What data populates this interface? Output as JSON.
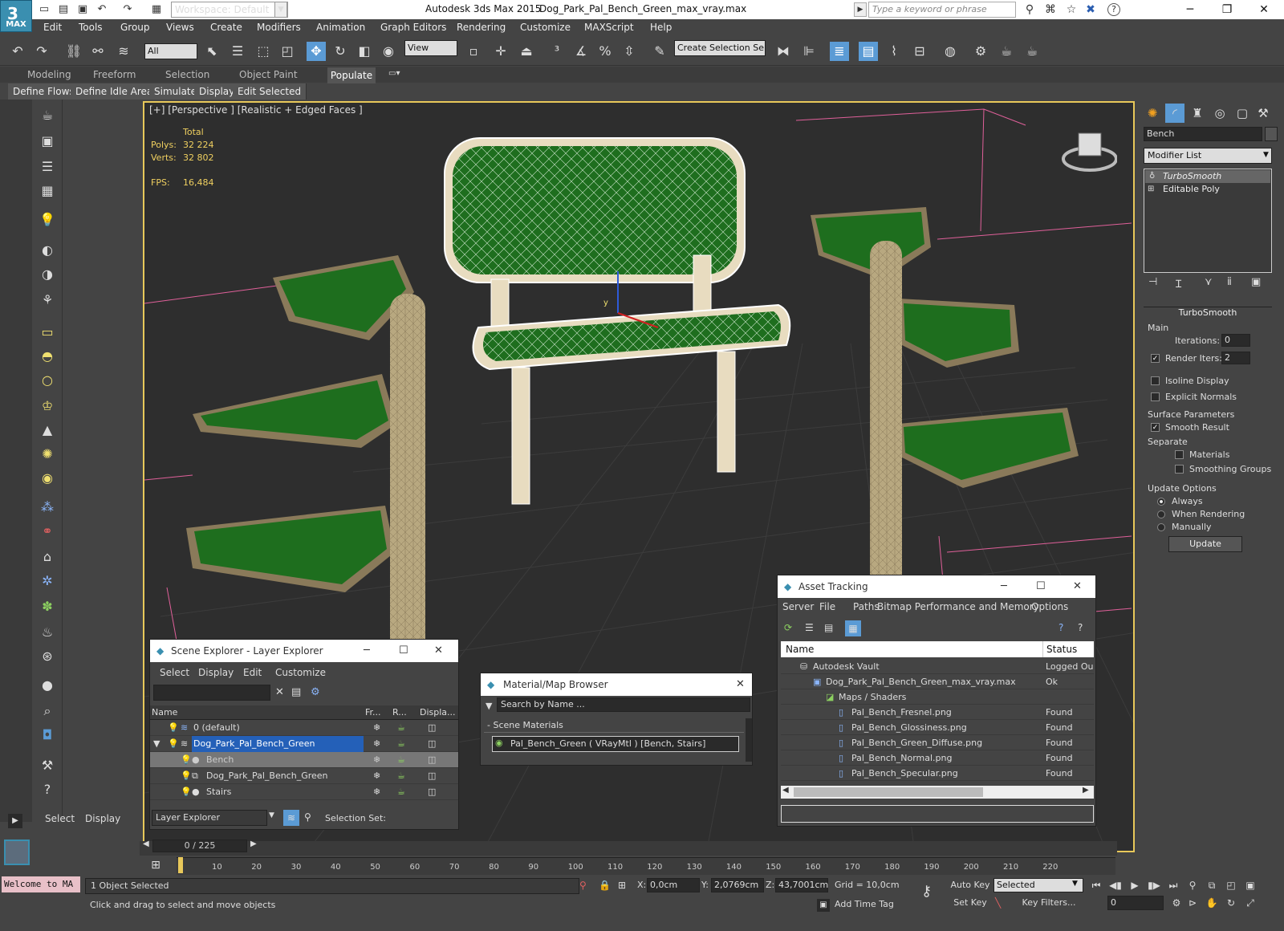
{
  "titlebar": {
    "app_title": "Autodesk 3ds Max  2015",
    "document": "Dog_Park_Pal_Bench_Green_max_vray.max",
    "workspace": "Workspace: Default",
    "search_placeholder": "Type a keyword or phrase",
    "logo_text": "MAX"
  },
  "menu": [
    "Edit",
    "Tools",
    "Group",
    "Views",
    "Create",
    "Modifiers",
    "Animation",
    "Graph Editors",
    "Rendering",
    "Customize",
    "MAXScript",
    "Help"
  ],
  "toolbar": {
    "filter": "All",
    "refcoord": "View",
    "selection_set": "Create Selection Se"
  },
  "ribbon": {
    "tabs": [
      "Modeling",
      "Freeform",
      "Selection",
      "Object Paint",
      "Populate"
    ],
    "active": "Populate",
    "buttons": [
      "Define Flows",
      "Define Idle Areas",
      "Simulate",
      "Display",
      "Edit Selected"
    ]
  },
  "viewport": {
    "label": "[+] [Perspective ] [Realistic + Edged Faces ]",
    "total_label": "Total",
    "polys_label": "Polys:",
    "polys": "32 224",
    "verts_label": "Verts:",
    "verts": "32 802",
    "fps_label": "FPS:",
    "fps": "16,484",
    "axis_y": "y"
  },
  "cmdpanel": {
    "object_name": "Bench",
    "modifier_list": "Modifier List",
    "stack": [
      "TurboSmooth",
      "Editable Poly"
    ],
    "turbosmooth": {
      "title": "TurboSmooth",
      "main": "Main",
      "iterations_label": "Iterations:",
      "iterations": "0",
      "render_iters_label": "Render Iters:",
      "render_iters": "2",
      "isoline": "Isoline Display",
      "explicit": "Explicit Normals",
      "surface": "Surface Parameters",
      "smooth_result": "Smooth Result",
      "separate": "Separate",
      "materials": "Materials",
      "smoothing_groups": "Smoothing Groups",
      "update_options": "Update Options",
      "always": "Always",
      "when_rendering": "When Rendering",
      "manually": "Manually",
      "update": "Update"
    }
  },
  "scene_explorer": {
    "title": "Scene Explorer - Layer Explorer",
    "menu": [
      "Select",
      "Display",
      "Edit",
      "Customize"
    ],
    "columns": [
      "Name",
      "Fr...",
      "R...",
      "Displa..."
    ],
    "rows": [
      {
        "name": "0 (default)"
      },
      {
        "name": "Dog_Park_Pal_Bench_Green"
      },
      {
        "name": "Bench"
      },
      {
        "name": "Dog_Park_Pal_Bench_Green"
      },
      {
        "name": "Stairs"
      }
    ],
    "footer_dd": "Layer Explorer",
    "selection_set": "Selection Set:"
  },
  "material_browser": {
    "title": "Material/Map Browser",
    "search": "Search by Name ...",
    "group": "- Scene Materials",
    "item": "Pal_Bench_Green  ( VRayMtl )  [Bench, Stairs]"
  },
  "asset_tracking": {
    "title": "Asset Tracking",
    "menu": [
      "Server",
      "File",
      "Paths",
      "Bitmap Performance and Memory",
      "Options"
    ],
    "columns": [
      "Name",
      "Status"
    ],
    "rows": [
      {
        "name": "Autodesk Vault",
        "status": "Logged Ou"
      },
      {
        "name": "Dog_Park_Pal_Bench_Green_max_vray.max",
        "status": "Ok"
      },
      {
        "name": "Maps / Shaders",
        "status": ""
      },
      {
        "name": "Pal_Bench_Fresnel.png",
        "status": "Found"
      },
      {
        "name": "Pal_Bench_Glossiness.png",
        "status": "Found"
      },
      {
        "name": "Pal_Bench_Green_Diffuse.png",
        "status": "Found"
      },
      {
        "name": "Pal_Bench_Normal.png",
        "status": "Found"
      },
      {
        "name": "Pal_Bench_Specular.png",
        "status": "Found"
      }
    ]
  },
  "left_panel": {
    "select": "Select",
    "display": "Display"
  },
  "timeline": {
    "frame": "0 / 225",
    "ticks": [
      "10",
      "20",
      "30",
      "40",
      "50",
      "60",
      "70",
      "80",
      "90",
      "100",
      "110",
      "120",
      "130",
      "140",
      "150",
      "160",
      "170",
      "180",
      "190",
      "200",
      "210",
      "220"
    ]
  },
  "status": {
    "welcome": "Welcome to MA",
    "selected": "1 Object Selected",
    "prompt": "Click and drag to select and move objects",
    "x_label": "X:",
    "x": "0,0cm",
    "y_label": "Y:",
    "y": "2,0769cm",
    "z_label": "Z:",
    "z": "43,7001cm",
    "grid": "Grid = 10,0cm",
    "add_time_tag": "Add Time Tag",
    "auto_key": "Auto Key",
    "set_key": "Set Key",
    "selected_dd": "Selected",
    "key_filters": "Key Filters...",
    "frame": "0"
  }
}
